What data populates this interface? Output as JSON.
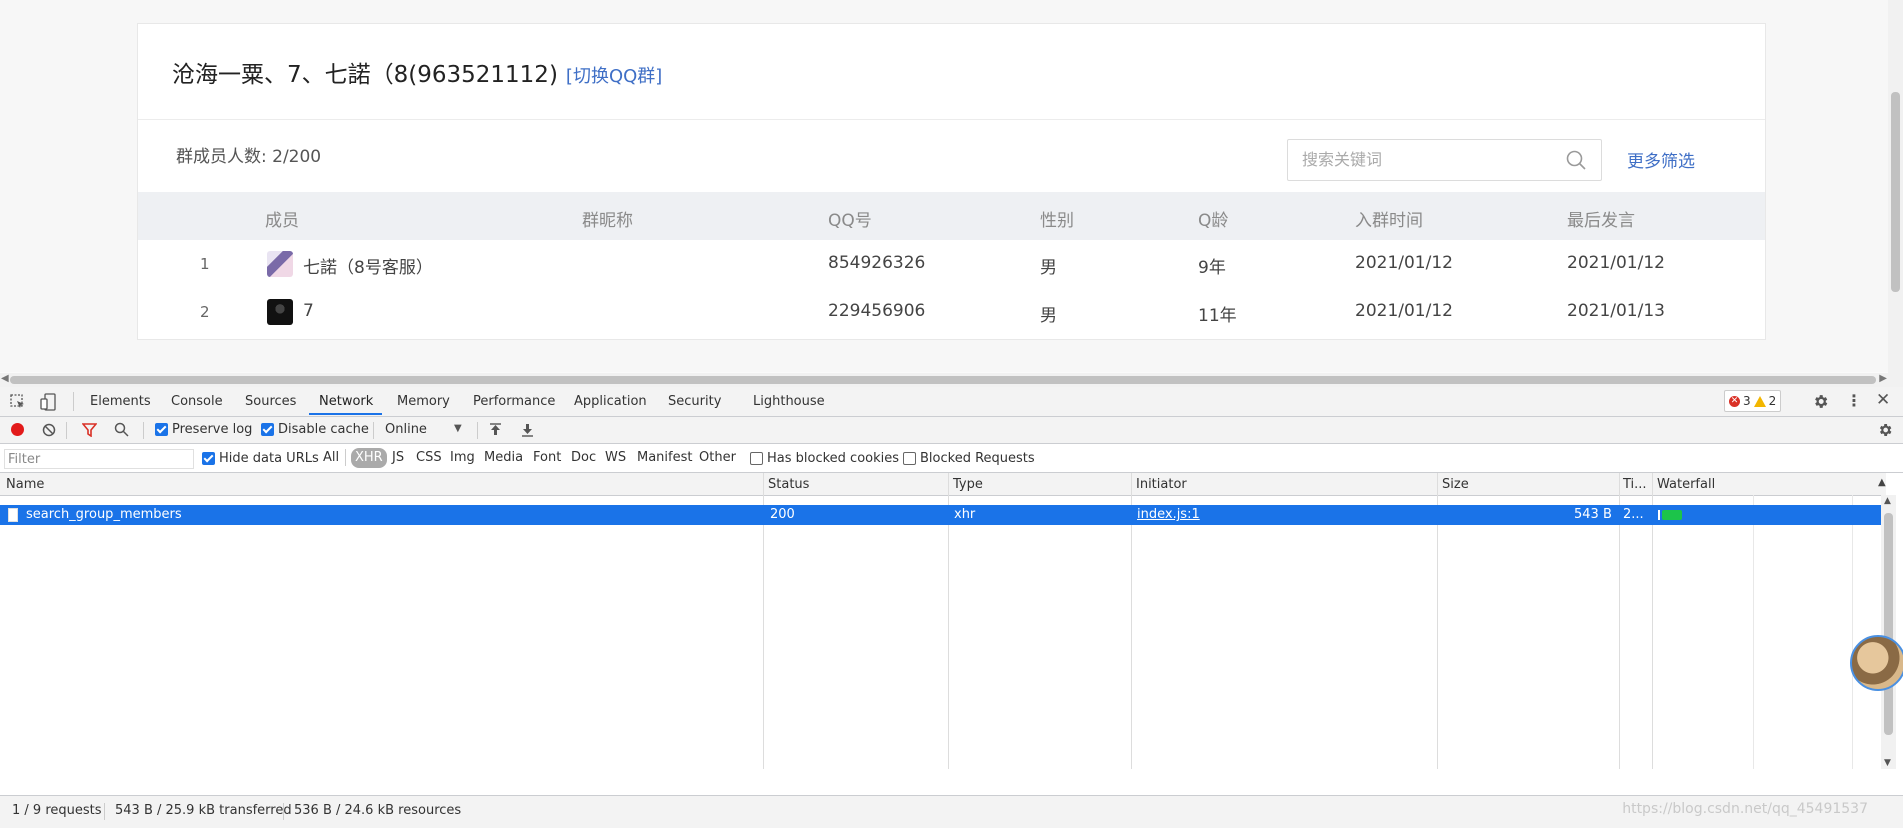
{
  "group": {
    "title": "沧海一粟、7、七諾（8(963521112)",
    "switch_link": "[切换QQ群]",
    "member_count": "群成员人数: 2/200",
    "search_placeholder": "搜索关键词",
    "more_filter": "更多筛选",
    "columns": [
      "成员",
      "群昵称",
      "QQ号",
      "性别",
      "Q龄",
      "入群时间",
      "最后发言"
    ],
    "rows": [
      {
        "index": "1",
        "name": "七諾（8号客服）",
        "nickname": "",
        "qq": "854926326",
        "gender": "男",
        "qage": "9年",
        "join": "2021/01/12",
        "last": "2021/01/12"
      },
      {
        "index": "2",
        "name": "7",
        "nickname": "",
        "qq": "229456906",
        "gender": "男",
        "qage": "11年",
        "join": "2021/01/12",
        "last": "2021/01/13"
      }
    ]
  },
  "devtools": {
    "tabs": [
      "Elements",
      "Console",
      "Sources",
      "Network",
      "Memory",
      "Performance",
      "Application",
      "Security",
      "Lighthouse"
    ],
    "active_tab": "Network",
    "errors": "3",
    "warnings": "2",
    "toolbar": {
      "preserve_log": "Preserve log",
      "disable_cache": "Disable cache",
      "throttle": "Online"
    },
    "filter": {
      "placeholder": "Filter",
      "hide_data_urls": "Hide data URLs",
      "types": [
        "All",
        "XHR",
        "JS",
        "CSS",
        "Img",
        "Media",
        "Font",
        "Doc",
        "WS",
        "Manifest",
        "Other"
      ],
      "active_type": "XHR",
      "has_blocked_cookies": "Has blocked cookies",
      "blocked_requests": "Blocked Requests"
    },
    "grid": {
      "columns": [
        "Name",
        "Status",
        "Type",
        "Initiator",
        "Size",
        "Ti...",
        "Waterfall"
      ],
      "rows": [
        {
          "name": "search_group_members",
          "status": "200",
          "type": "xhr",
          "initiator": "index.js:1",
          "size": "543 B",
          "time": "2..."
        }
      ]
    },
    "status": {
      "requests": "1 / 9 requests",
      "transferred": "543 B / 25.9 kB transferred",
      "resources": "536 B / 24.6 kB resources",
      "watermark": "https://blog.csdn.net/qq_45491537"
    }
  },
  "colors": {
    "link": "#3f6fc6",
    "selection": "#1a73e8",
    "waterfall": "#1cc44a",
    "error": "#d93025",
    "warning": "#f2b600"
  }
}
